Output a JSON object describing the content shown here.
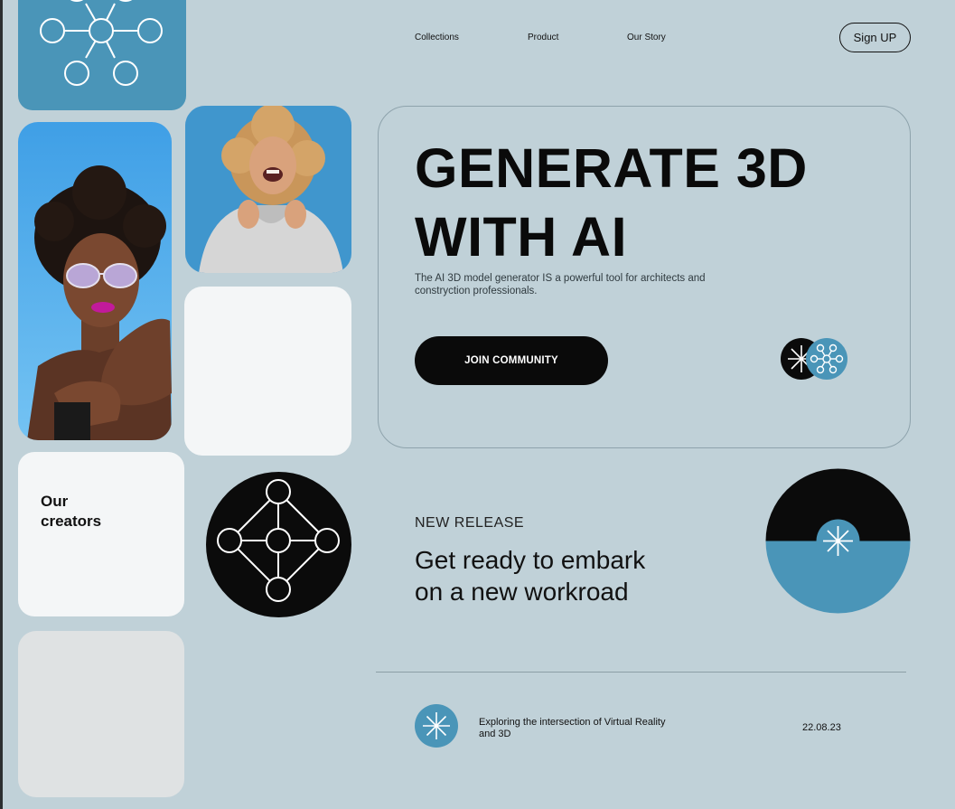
{
  "nav": {
    "links": [
      "Collections",
      "Product",
      "Our Story"
    ],
    "signup_label": "Sign UP"
  },
  "hero": {
    "title_line1": "GENERATE 3D",
    "title_line2": "WITH AI",
    "subtitle": "The AI 3D model generator IS a powerful tool for architects and constryction professionals.",
    "cta_label": "JOIN COMMUNITY"
  },
  "creators": {
    "label_line1": "Our",
    "label_line2": "creators"
  },
  "release": {
    "label": "NEW RELEASE",
    "title_line1": "Get ready to embark",
    "title_line2": "on a new workroad"
  },
  "article": {
    "text": "Exploring the intersection of Virtual Reality and 3D",
    "date": "22.08.23"
  },
  "colors": {
    "background": "#c0d1d8",
    "accent_blue": "#4a95b8",
    "dark": "#0b0b0b",
    "card_white": "#f4f6f7",
    "card_gray": "#dfe2e3"
  },
  "icons": [
    "network-icon",
    "sparkle-icon",
    "diamond-network-icon"
  ]
}
